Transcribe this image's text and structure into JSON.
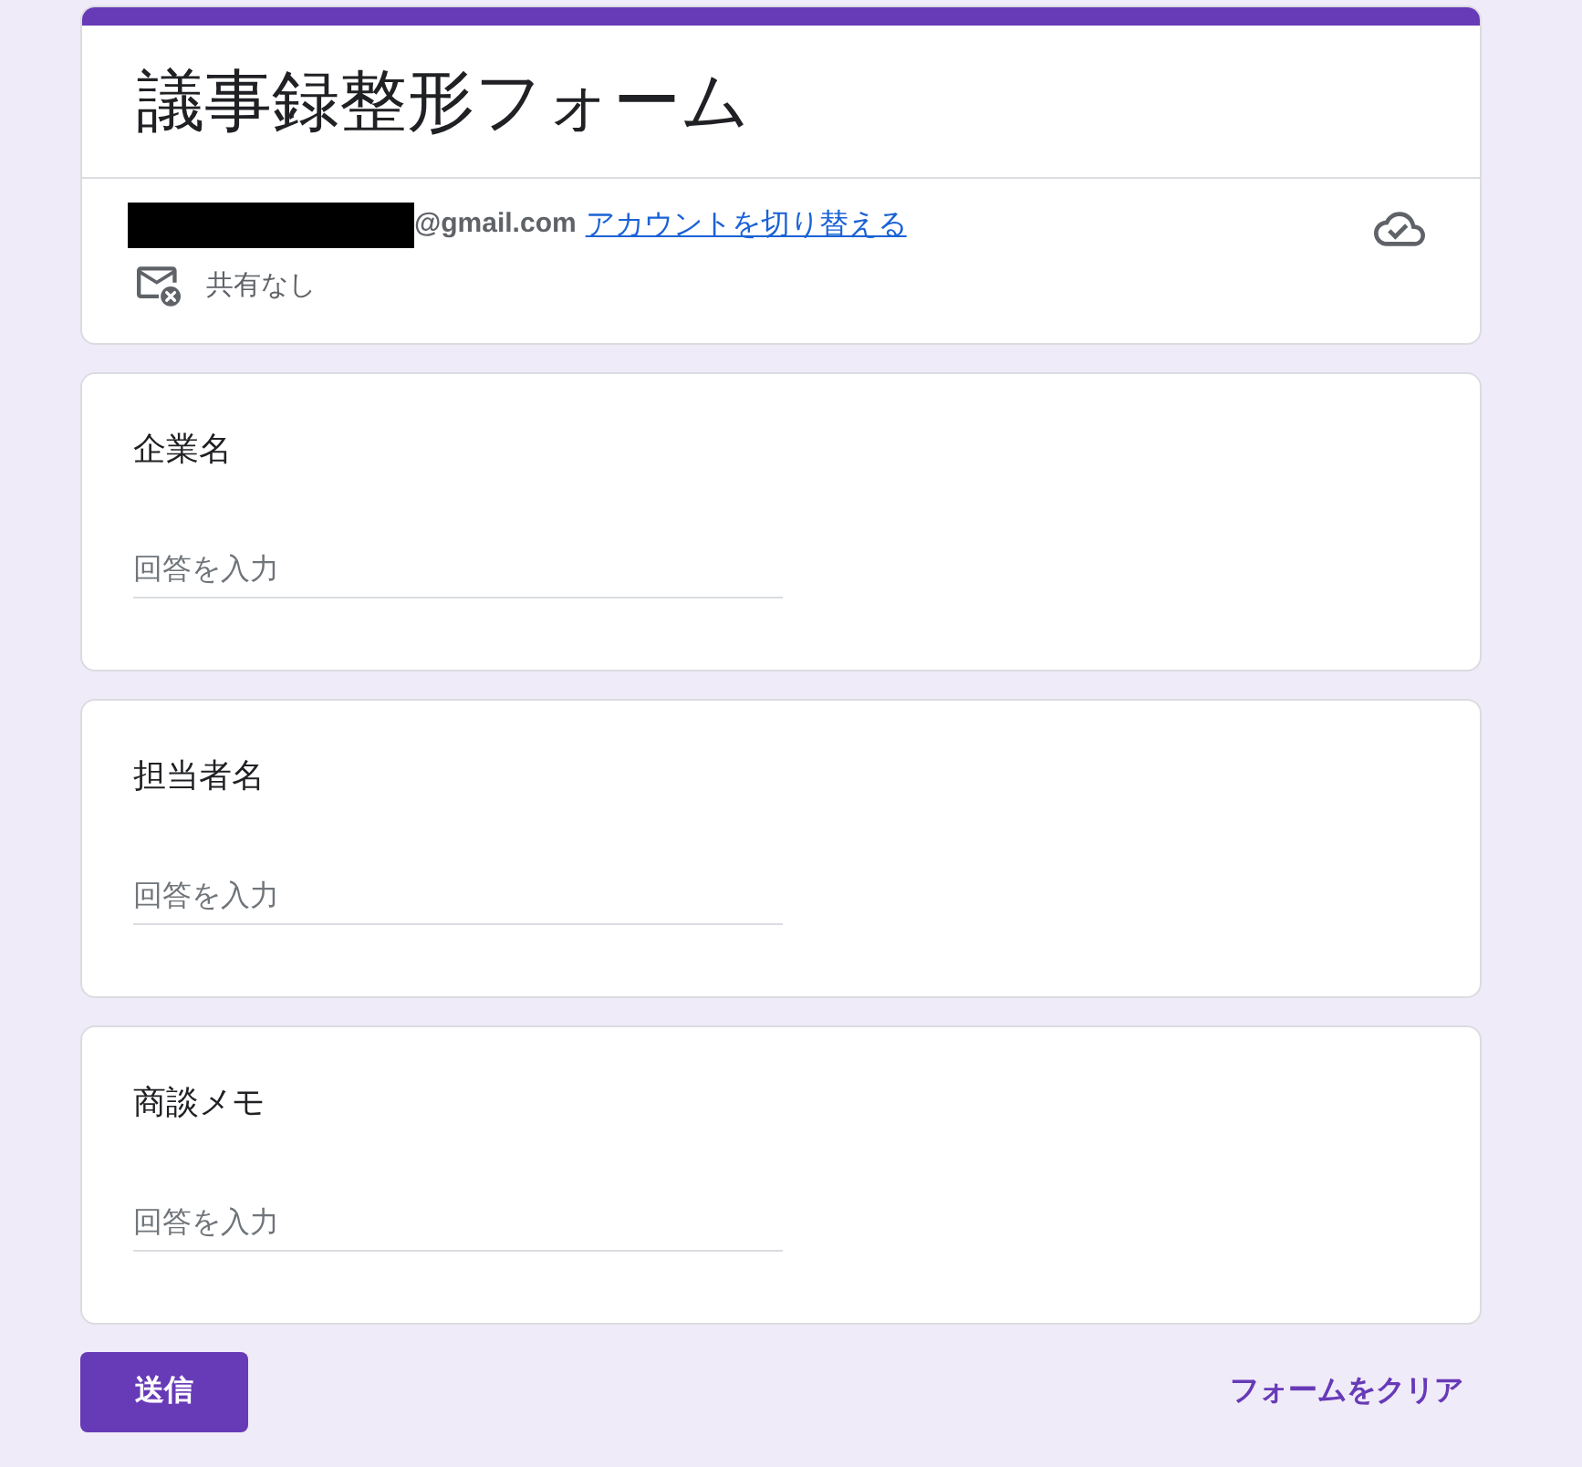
{
  "header": {
    "title": "議事録整形フォーム",
    "account": {
      "email": "@gmail.com",
      "switch_link": "アカウントを切り替える"
    },
    "sharing": "共有なし"
  },
  "questions": [
    {
      "label": "企業名",
      "placeholder": "回答を入力"
    },
    {
      "label": "担当者名",
      "placeholder": "回答を入力"
    },
    {
      "label": "商談メモ",
      "placeholder": "回答を入力"
    }
  ],
  "actions": {
    "submit": "送信",
    "clear": "フォームをクリア"
  }
}
